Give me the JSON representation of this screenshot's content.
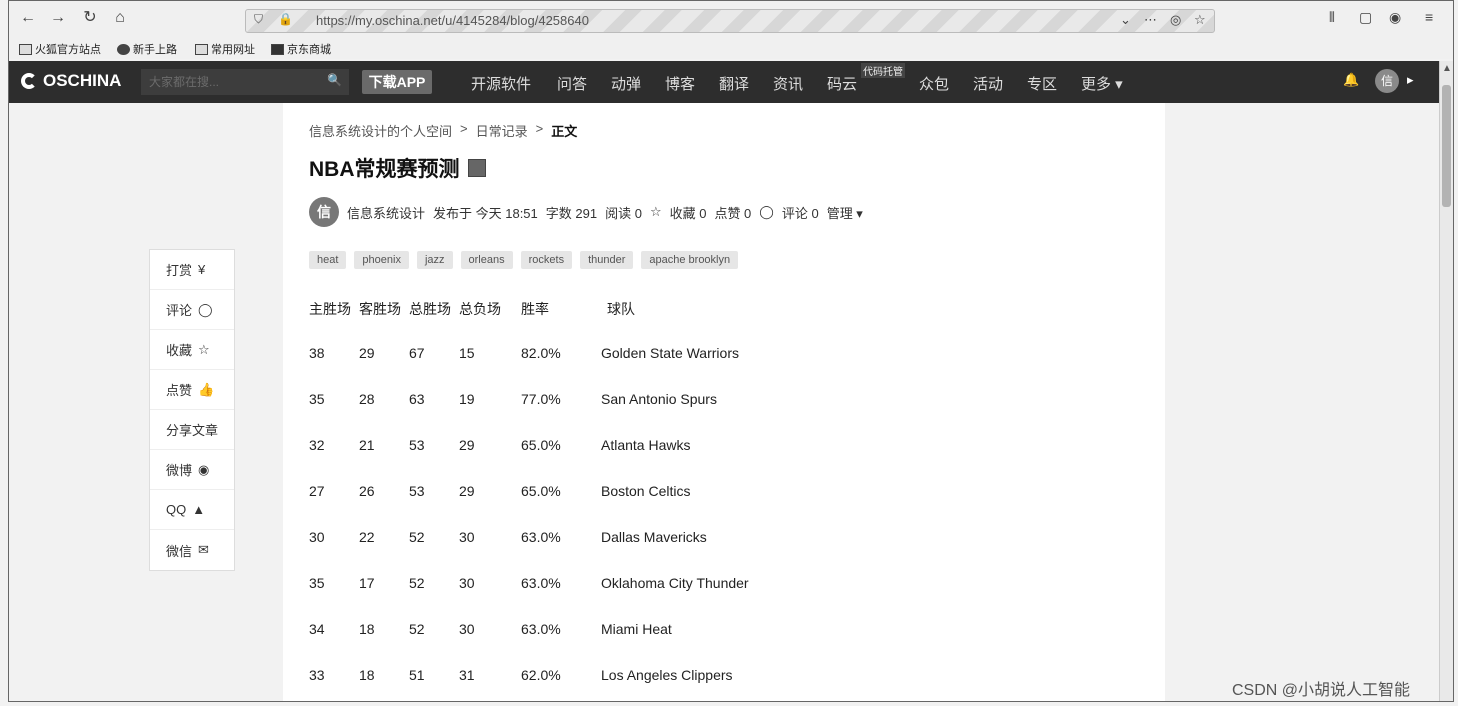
{
  "browser": {
    "url": "https://my.oschina.net/u/4145284/blog/4258640",
    "bookmarks": [
      "火狐官方站点",
      "新手上路",
      "常用网址",
      "京东商城"
    ]
  },
  "header": {
    "logo": "OSCHINA",
    "search_placeholder": "大家都在搜...",
    "download_label": "下载APP",
    "nav": [
      "开源软件",
      "问答",
      "动弹",
      "博客",
      "翻译",
      "资讯",
      "码云",
      "众包",
      "活动",
      "专区",
      "更多 ▾"
    ],
    "nav_badge": "代码托管",
    "user_avatar": "信"
  },
  "article": {
    "breadcrumb": [
      "信息系统设计的个人空间",
      "日常记录",
      "正文"
    ],
    "title": "NBA常规赛预测",
    "author_avatar": "信",
    "meta": {
      "author": "信息系统设计",
      "published": "发布于 今天 18:51",
      "words": "字数 291",
      "reads": "阅读 0",
      "favorites": "收藏 0",
      "likes": "点赞 0",
      "comments": "评论 0",
      "manage": "管理 ▾"
    },
    "tags": [
      "heat",
      "phoenix",
      "jazz",
      "orleans",
      "rockets",
      "thunder",
      "apache brooklyn"
    ]
  },
  "table": {
    "headers": [
      "主胜场",
      "客胜场",
      "总胜场",
      "总负场",
      "胜率",
      "球队"
    ],
    "rows": [
      [
        "38",
        "29",
        "67",
        "15",
        "82.0%",
        "Golden State Warriors"
      ],
      [
        "35",
        "28",
        "63",
        "19",
        "77.0%",
        "San Antonio Spurs"
      ],
      [
        "32",
        "21",
        "53",
        "29",
        "65.0%",
        "Atlanta Hawks"
      ],
      [
        "27",
        "26",
        "53",
        "29",
        "65.0%",
        "Boston Celtics"
      ],
      [
        "30",
        "22",
        "52",
        "30",
        "63.0%",
        "Dallas Mavericks"
      ],
      [
        "35",
        "17",
        "52",
        "30",
        "63.0%",
        "Oklahoma City Thunder"
      ],
      [
        "34",
        "18",
        "52",
        "30",
        "63.0%",
        "Miami Heat"
      ],
      [
        "33",
        "18",
        "51",
        "31",
        "62.0%",
        "Los Angeles Clippers"
      ]
    ]
  },
  "share": [
    "打赏",
    "评论",
    "收藏",
    "点赞",
    "分享文章",
    "微博",
    "QQ",
    "微信"
  ],
  "share_icons": [
    "¥",
    "◯",
    "☆",
    "👍",
    "",
    "◉",
    "▲",
    "✉"
  ],
  "watermark": "CSDN @小胡说人工智能"
}
